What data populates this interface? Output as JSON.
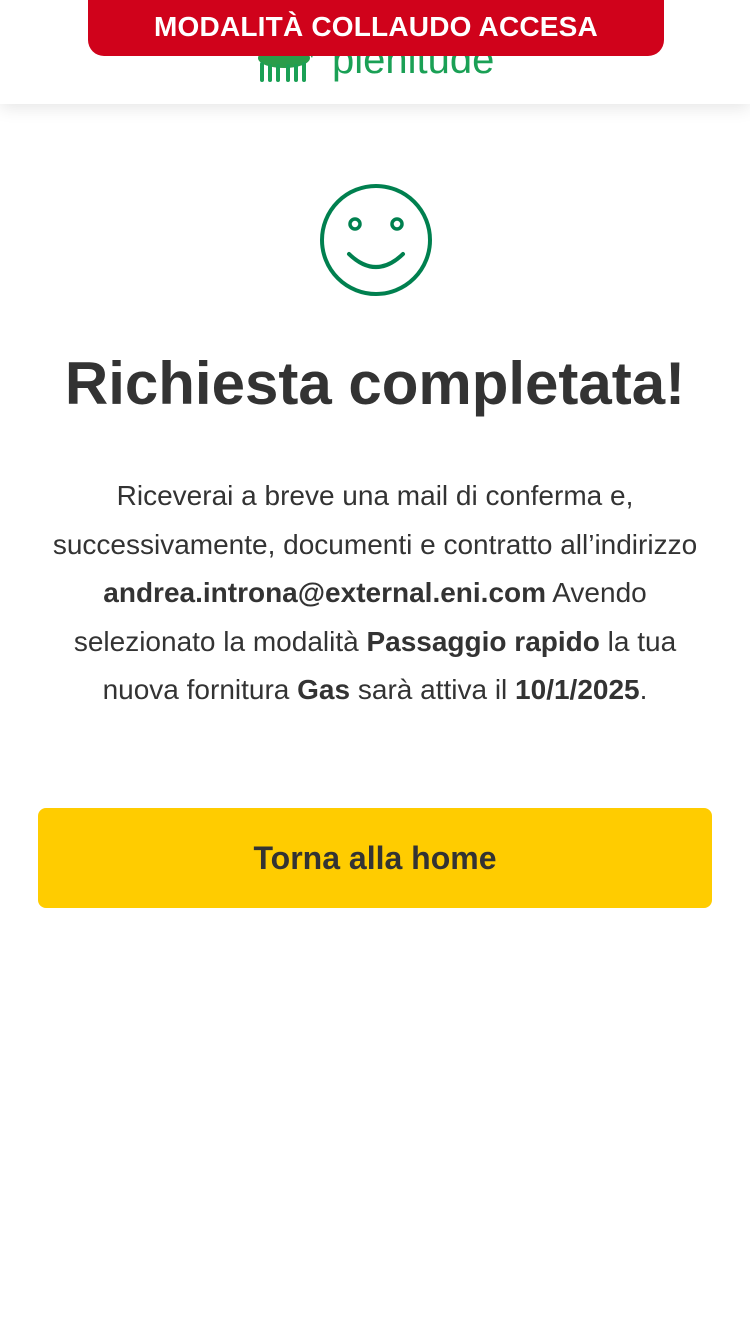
{
  "banner": {
    "text": "MODALITÀ COLLAUDO ACCESA",
    "color": "#d0021b"
  },
  "header": {
    "logo_text": "plenitude",
    "logo_icon": "six-legged-dog-icon",
    "brand_color": "#1aa055"
  },
  "status_icon": "smiley-icon",
  "title": "Richiesta completata!",
  "message": {
    "part1": "Riceverai a breve una mail di conferma e, successivamente, documenti e contratto all’indirizzo ",
    "email": "andrea.introna@external.eni.com",
    "part2": " Avendo selezionato la modalità ",
    "mode": "Passaggio rapido",
    "part3": " la tua nuova fornitura ",
    "supply": "Gas",
    "part4": " sarà attiva il ",
    "date": "10/1/2025",
    "part5": "."
  },
  "button": {
    "label": "Torna alla home",
    "color": "#ffcc00"
  }
}
